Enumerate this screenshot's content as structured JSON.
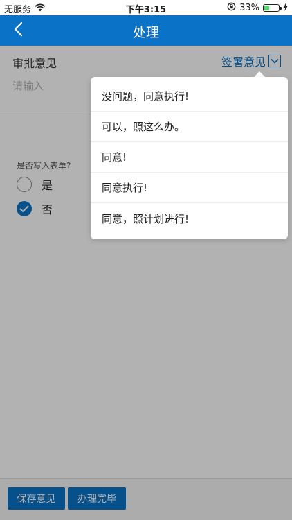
{
  "statusbar": {
    "carrier": "无服务",
    "time": "下午3:15",
    "battery_percent": "33%",
    "battery_level": 0.33,
    "wifi_icon": "wifi-icon",
    "lock_icon": "orientation-lock-icon",
    "charging_icon": "charging-bolt-icon"
  },
  "navbar": {
    "title": "处理",
    "back_icon": "chevron-left-icon"
  },
  "form": {
    "section_label": "审批意见",
    "sign_opinion_label": "签署意见",
    "input_placeholder": "请输入",
    "write_label": "是否写入表单?",
    "options": [
      {
        "label": "是",
        "checked": false
      },
      {
        "label": "否",
        "checked": true
      }
    ]
  },
  "popover": {
    "items": [
      "没问题，同意执行!",
      "可以，照这么办。",
      "同意!",
      "同意执行!",
      "同意，照计划进行!"
    ]
  },
  "toolbar": {
    "save_label": "保存意见",
    "done_label": "办理完毕"
  },
  "colors": {
    "primary": "#0a73c7",
    "battery_green": "#4cd964"
  }
}
